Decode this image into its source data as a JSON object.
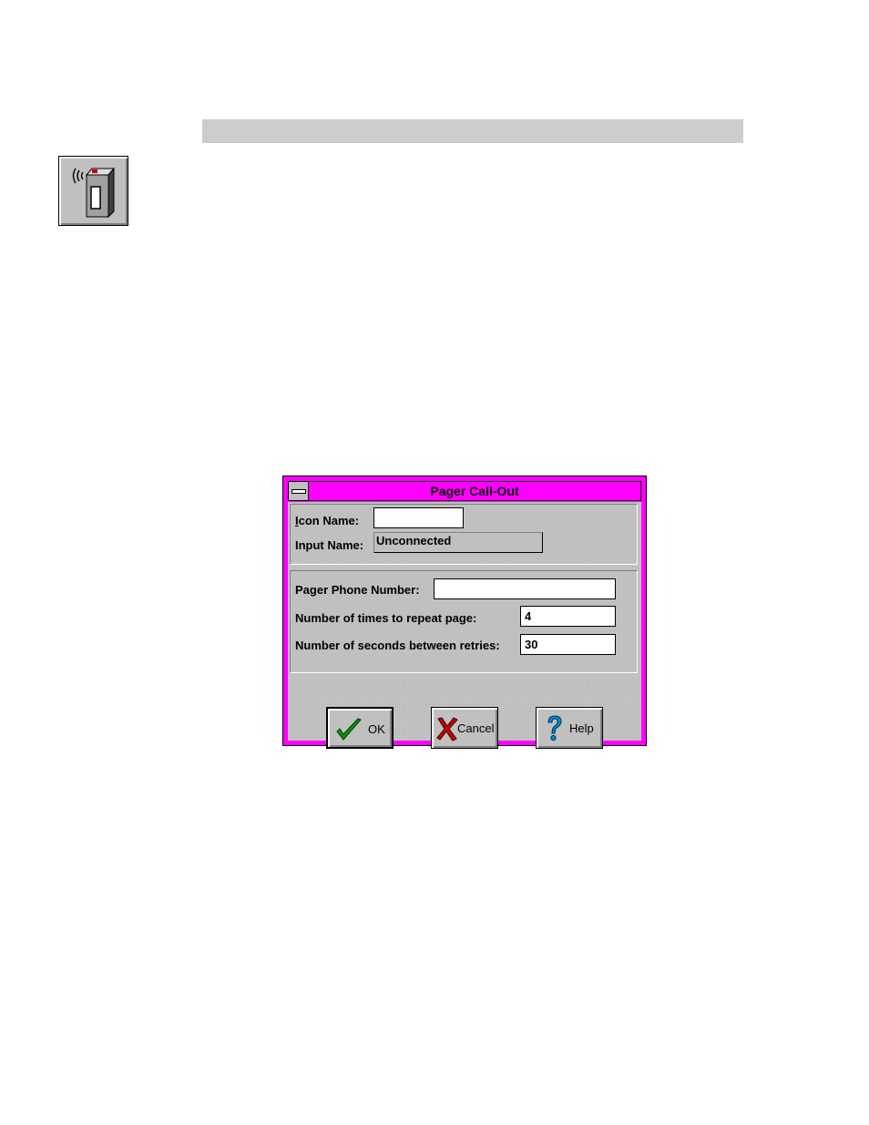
{
  "dialog": {
    "title": "Pager Call-Out",
    "icon_name": {
      "label_accel": "I",
      "label_rest": "con Name:",
      "value": ""
    },
    "input_name": {
      "label": "Input Name:",
      "value": "Unconnected"
    },
    "pager_phone": {
      "label": "Pager Phone Number:",
      "value": ""
    },
    "repeat_count": {
      "label": "Number of times to repeat page:",
      "value": "4"
    },
    "retry_seconds": {
      "label": "Number of seconds between retries:",
      "value": "30"
    },
    "buttons": {
      "ok": "OK",
      "cancel": "Cancel",
      "help": "Help"
    }
  },
  "icons": {
    "toolbar": "pager-icon",
    "ok": "checkmark-icon",
    "cancel": "red-x-icon",
    "help": "question-mark-icon",
    "system_menu": "system-menu-icon"
  },
  "colors": {
    "title_bar": "#ff00ff",
    "frame": "#ff00ff",
    "face": "#c0c0c0",
    "header_band": "#cccccc",
    "ok_check": "#009900",
    "cancel_x": "#cc0000",
    "help_mark": "#0088cc"
  }
}
